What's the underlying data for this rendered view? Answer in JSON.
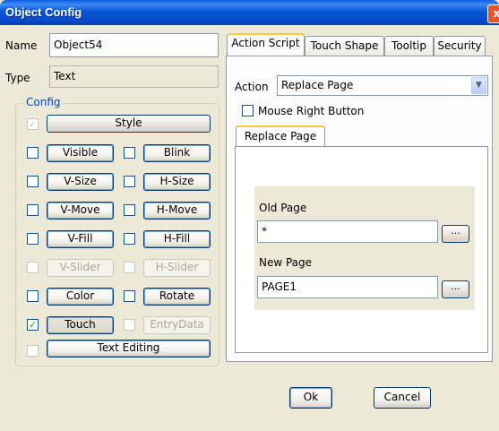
{
  "window": {
    "title": "Object Config",
    "close_glyph": "x"
  },
  "left": {
    "name_label": "Name",
    "name_value": "Object54",
    "type_label": "Type",
    "type_value": "Text",
    "config_title": "Config",
    "check_mark": "✓",
    "rows": {
      "style": {
        "label": "Style",
        "checked": true,
        "disabled": true
      },
      "visible": {
        "label": "Visible",
        "checked": false
      },
      "blink": {
        "label": "Blink",
        "checked": false
      },
      "vsize": {
        "label": "V-Size",
        "checked": false
      },
      "hsize": {
        "label": "H-Size",
        "checked": false
      },
      "vmove": {
        "label": "V-Move",
        "checked": false
      },
      "hmove": {
        "label": "H-Move",
        "checked": false
      },
      "vfill": {
        "label": "V-Fill",
        "checked": false
      },
      "hfill": {
        "label": "H-Fill",
        "checked": false
      },
      "vslider": {
        "label": "V-Slider",
        "checked": false,
        "disabled": true
      },
      "hslider": {
        "label": "H-Slider",
        "checked": false,
        "disabled": true
      },
      "color": {
        "label": "Color",
        "checked": false
      },
      "rotate": {
        "label": "Rotate",
        "checked": false
      },
      "touch": {
        "label": "Touch",
        "checked": true,
        "pressed": true
      },
      "entrydata": {
        "label": "EntryData",
        "checked": false,
        "disabled": true
      },
      "textediting": {
        "label": "Text Editing",
        "checked": false,
        "disabled": true
      }
    }
  },
  "tabs": [
    {
      "label": "Action Script",
      "active": true
    },
    {
      "label": "Touch Shape"
    },
    {
      "label": "Tooltip"
    },
    {
      "label": "Security"
    }
  ],
  "action": {
    "label": "Action",
    "value": "Replace Page",
    "dropdown_icon": "chevron-down-icon",
    "mouse_right_label": "Mouse Right Button",
    "mouse_right_checked": false,
    "subtab": "Replace Page",
    "old_page_label": "Old Page",
    "old_page_value": "*",
    "new_page_label": "New Page",
    "new_page_value": "PAGE1",
    "browse_label": "..."
  },
  "footer": {
    "ok_label": "Ok",
    "cancel_label": "Cancel"
  },
  "colors": {
    "titlebar": "#0A5FE0",
    "group_title": "#0046D5",
    "check": "#21A121",
    "tab_highlight": "#FFC83C"
  }
}
